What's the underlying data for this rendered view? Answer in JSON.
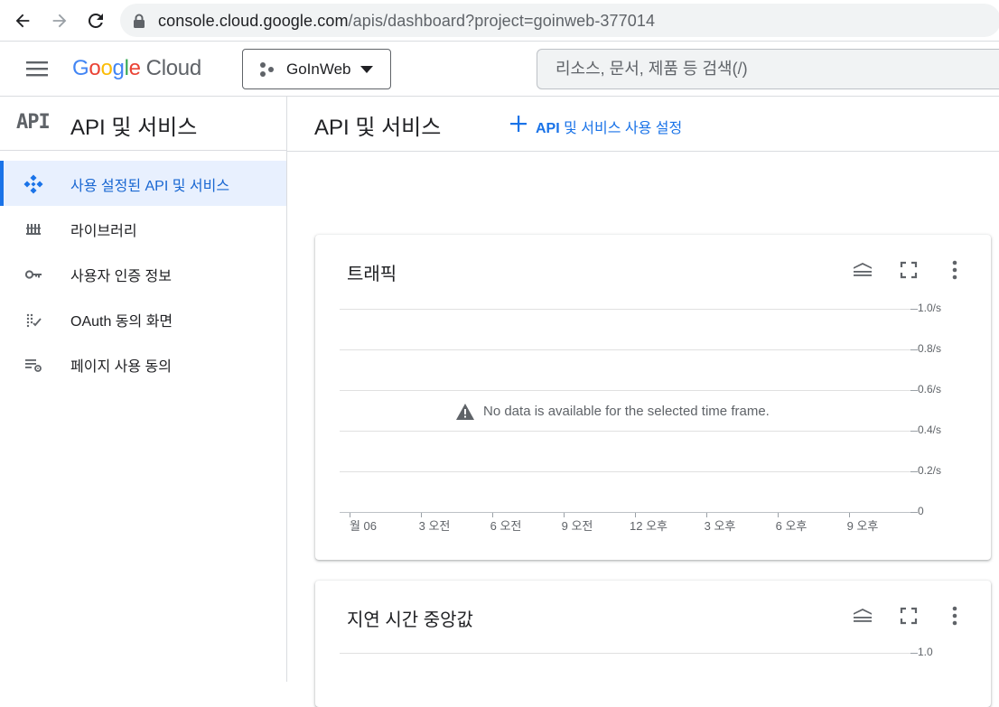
{
  "browser": {
    "url_host": "console.cloud.google.com",
    "url_path": "/apis/dashboard?project=goinweb-377014"
  },
  "header": {
    "logo": {
      "g1": "G",
      "g2": "o",
      "g3": "o",
      "g4": "g",
      "g5": "l",
      "g6": "e",
      "cloud": "Cloud"
    },
    "project": "GoInWeb",
    "search_placeholder": "리소스, 문서, 제품 등 검색(/)"
  },
  "sidebar": {
    "glyph": "API",
    "title": "API 및 서비스",
    "items": [
      {
        "label": "사용 설정된 API 및 서비스",
        "icon": "api-diamond-icon",
        "active": true
      },
      {
        "label": "라이브러리",
        "icon": "library-icon",
        "active": false
      },
      {
        "label": "사용자 인증 정보",
        "icon": "key-icon",
        "active": false
      },
      {
        "label": "OAuth 동의 화면",
        "icon": "oauth-consent-icon",
        "active": false
      },
      {
        "label": "페이지 사용 동의",
        "icon": "page-usage-settings-icon",
        "active": false
      }
    ]
  },
  "main": {
    "title": "API 및 서비스",
    "enable_api": {
      "prefix": "API",
      "rest": " 및 서비스 사용 설정"
    }
  },
  "cards": [
    {
      "title": "트래픽",
      "no_data": "No data is available for the selected time frame."
    },
    {
      "title": "지연 시간 중앙값"
    }
  ],
  "chart_data": [
    {
      "type": "line",
      "title": "트래픽",
      "x": [
        "월 06",
        "3 오전",
        "6 오전",
        "9 오전",
        "12 오후",
        "3 오후",
        "6 오후",
        "9 오후"
      ],
      "series": [],
      "y_ticks": [
        "0",
        "0.2/s",
        "0.4/s",
        "0.6/s",
        "0.8/s",
        "1.0/s"
      ],
      "ylim": [
        0,
        1.0
      ],
      "grid": true,
      "annotation": "No data is available for the selected time frame."
    },
    {
      "type": "line",
      "title": "지연 시간 중앙값",
      "series": [],
      "y_ticks": [
        "1.0"
      ],
      "grid": true
    }
  ],
  "colors": {
    "accent": "#1a73e8",
    "active_bg": "#e8f0fe",
    "text": "#202124",
    "muted": "#5f6368"
  }
}
